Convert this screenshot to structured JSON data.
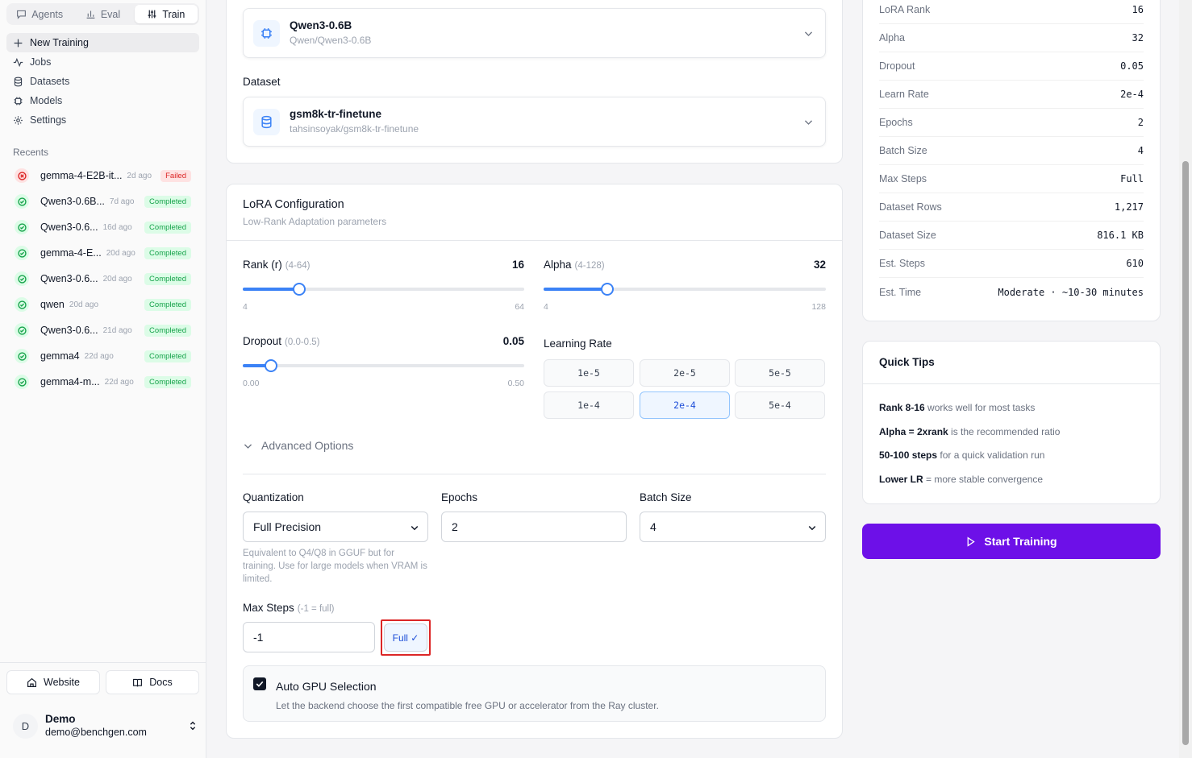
{
  "topnav": {
    "tabs": [
      {
        "label": "Agents",
        "icon": "chat-icon"
      },
      {
        "label": "Eval",
        "icon": "bar-chart-icon"
      },
      {
        "label": "Train",
        "icon": "sliders-icon"
      }
    ],
    "active": "Train"
  },
  "nav": {
    "items": [
      {
        "label": "New Training",
        "icon": "plus-icon"
      },
      {
        "label": "Jobs",
        "icon": "activity-icon"
      },
      {
        "label": "Datasets",
        "icon": "database-icon"
      },
      {
        "label": "Models",
        "icon": "chip-icon"
      },
      {
        "label": "Settings",
        "icon": "gear-icon"
      }
    ]
  },
  "recents": {
    "title": "Recents",
    "items": [
      {
        "name": "gemma-4-E2B-it...",
        "time": "2d ago",
        "status": "Failed"
      },
      {
        "name": "Qwen3-0.6B...",
        "time": "7d ago",
        "status": "Completed"
      },
      {
        "name": "Qwen3-0.6...",
        "time": "16d ago",
        "status": "Completed"
      },
      {
        "name": "gemma-4-E...",
        "time": "20d ago",
        "status": "Completed"
      },
      {
        "name": "Qwen3-0.6...",
        "time": "20d ago",
        "status": "Completed"
      },
      {
        "name": "qwen",
        "time": "20d ago",
        "status": "Completed"
      },
      {
        "name": "Qwen3-0.6...",
        "time": "21d ago",
        "status": "Completed"
      },
      {
        "name": "gemma4",
        "time": "22d ago",
        "status": "Completed"
      },
      {
        "name": "gemma4-m...",
        "time": "22d ago",
        "status": "Completed"
      }
    ]
  },
  "footer": {
    "website": "Website",
    "docs": "Docs",
    "user": {
      "initial": "D",
      "name": "Demo",
      "email": "demo@benchgen.com"
    }
  },
  "model_picker": {
    "title": "Qwen3-0.6B",
    "subtitle": "Qwen/Qwen3-0.6B"
  },
  "dataset": {
    "label": "Dataset",
    "title": "gsm8k-tr-finetune",
    "subtitle": "tahsinsoyak/gsm8k-tr-finetune"
  },
  "lora": {
    "title": "LoRA Configuration",
    "subtitle": "Low-Rank Adaptation parameters",
    "rank": {
      "label": "Rank (r)",
      "range": "(4-64)",
      "value": "16",
      "min": "4",
      "max": "64",
      "fraction": 0.2
    },
    "alpha": {
      "label": "Alpha",
      "range": "(4-128)",
      "value": "32",
      "min": "4",
      "max": "128",
      "fraction": 0.2258
    },
    "dropout": {
      "label": "Dropout",
      "range": "(0.0-0.5)",
      "value": "0.05",
      "min": "0.00",
      "max": "0.50",
      "fraction": 0.1
    },
    "learning_rate": {
      "label": "Learning Rate",
      "options": [
        "1e-5",
        "2e-5",
        "5e-5",
        "1e-4",
        "2e-4",
        "5e-4"
      ],
      "selected": "2e-4"
    }
  },
  "advanced": {
    "toggle_label": "Advanced Options",
    "quantization": {
      "label": "Quantization",
      "value": "Full Precision",
      "hint": "Equivalent to Q4/Q8 in GGUF but for training. Use for large models when VRAM is limited."
    },
    "epochs": {
      "label": "Epochs",
      "value": "2"
    },
    "batch_size": {
      "label": "Batch Size",
      "value": "4"
    },
    "max_steps": {
      "label": "Max Steps",
      "hint": "(-1 = full)",
      "value": "-1",
      "full_button": "Full ✓"
    },
    "auto_gpu": {
      "label": "Auto GPU Selection",
      "description": "Let the backend choose the first compatible free GPU or accelerator from the Ray cluster.",
      "checked": true
    }
  },
  "summary": {
    "rows": [
      {
        "key": "LoRA Rank",
        "value": "16"
      },
      {
        "key": "Alpha",
        "value": "32"
      },
      {
        "key": "Dropout",
        "value": "0.05"
      },
      {
        "key": "Learn Rate",
        "value": "2e-4"
      },
      {
        "key": "Epochs",
        "value": "2"
      },
      {
        "key": "Batch Size",
        "value": "4"
      },
      {
        "key": "Max Steps",
        "value": "Full"
      },
      {
        "key": "Dataset Rows",
        "value": "1,217"
      },
      {
        "key": "Dataset Size",
        "value": "816.1 KB"
      },
      {
        "key": "Est. Steps",
        "value": "610"
      },
      {
        "key": "Est. Time",
        "value": "Moderate · ~10-30 minutes"
      }
    ]
  },
  "tips": {
    "title": "Quick Tips",
    "items": [
      {
        "bold": "Rank 8-16",
        "text": " works well for most tasks"
      },
      {
        "bold": "Alpha = 2xrank",
        "text": " is the recommended ratio"
      },
      {
        "bold": "50-100 steps",
        "text": " for a quick validation run"
      },
      {
        "bold": "Lower LR",
        "text": " = more stable convergence"
      }
    ]
  },
  "start_button": "Start Training",
  "colors": {
    "accent": "#3b82f6",
    "primary_button": "#6d10e8",
    "success": "#16a34a",
    "danger": "#dc2626"
  }
}
